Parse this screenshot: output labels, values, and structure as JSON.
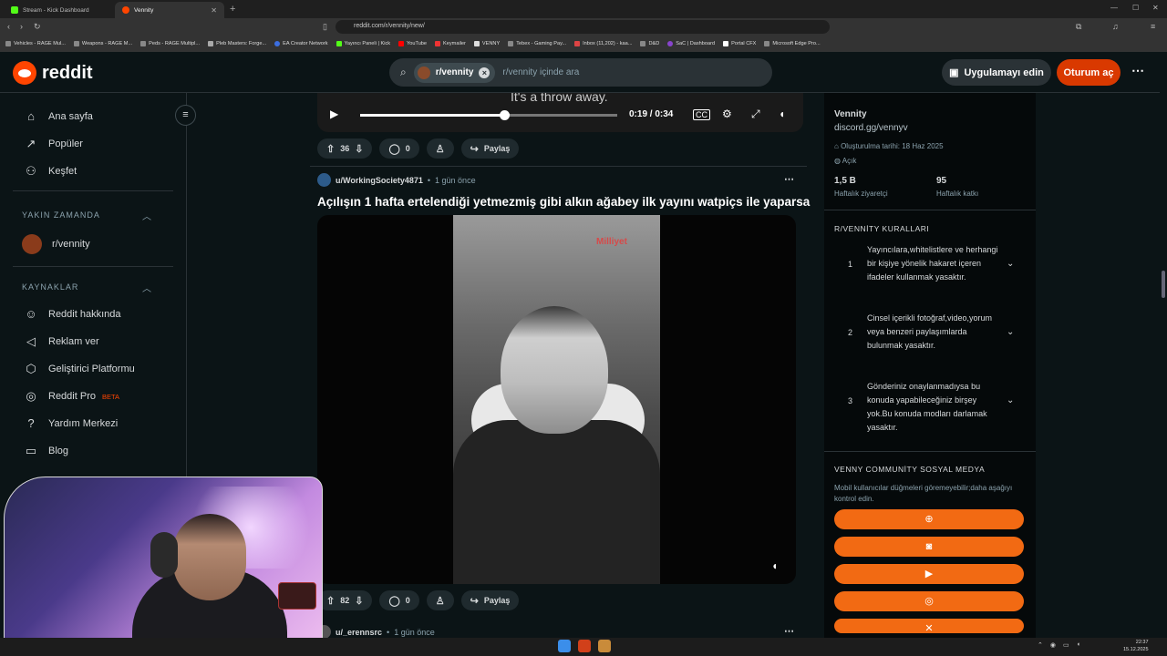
{
  "browser": {
    "tabs": [
      {
        "title": "Stream - Kick Dashboard",
        "color": "#53fc18"
      },
      {
        "title": "Vennity",
        "color": "#ff4500"
      }
    ],
    "url": "reddit.com/r/vennity/new/",
    "bookmarks": [
      "Vehicles - RAGE Mul...",
      "Weapons - RAGE M...",
      "Peds - RAGE Multipl...",
      "Pleb Masters: Forge...",
      "EA Creator Network",
      "Yayıncı Paneli | Kick",
      "YouTube",
      "Keymailer",
      "VENNY",
      "Tebex - Gaming Pay...",
      "Inbox (11,202) - kaa...",
      "D&D",
      "SaC | Dashboard",
      "Portal CFX",
      "Microsoft Edge Pro..."
    ]
  },
  "header": {
    "logo_text": "reddit",
    "search_chip": "r/vennity",
    "search_placeholder": "r/vennity içinde ara",
    "get_app_label": "Uygulamayı edin",
    "login_label": "Oturum aç"
  },
  "leftnav": {
    "items": [
      {
        "label": "Ana sayfa",
        "icon": "home-icon"
      },
      {
        "label": "Popüler",
        "icon": "popular-icon"
      },
      {
        "label": "Keşfet",
        "icon": "explore-icon"
      }
    ],
    "recent_title": "YAKIN ZAMANDA",
    "recent_items": [
      "r/vennity"
    ],
    "resources_title": "KAYNAKLAR",
    "resources": [
      {
        "label": "Reddit hakkında",
        "icon": "reddit-icon"
      },
      {
        "label": "Reklam ver",
        "icon": "megaphone-icon"
      },
      {
        "label": "Geliştirici Platformu",
        "icon": "hexagon-icon"
      },
      {
        "label": "Reddit Pro",
        "badge": "BETA",
        "icon": "reddit-pro-icon"
      },
      {
        "label": "Yardım Merkezi",
        "icon": "help-icon"
      },
      {
        "label": "Blog",
        "icon": "book-icon"
      }
    ]
  },
  "posts": [
    {
      "video_caption": "It's a throw away.",
      "video_time": "0:19 / 0:34",
      "video_progress": 0.56,
      "votes": "36",
      "comments": "0",
      "share_label": "Paylaş"
    },
    {
      "user": "u/WorkingSociety4871",
      "time": "1 gün önce",
      "title": "Açılışın 1 hafta ertelendiği yetmezmiş gibi alkın ağabey ilk yayını watpiçs ile yaparsa",
      "watermark": "Milliyet",
      "votes": "82",
      "comments": "0",
      "share_label": "Paylaş"
    },
    {
      "user": "u/_erennsrc",
      "time": "1 gün önce"
    }
  ],
  "community": {
    "name": "Vennity",
    "link": "discord.gg/vennyv",
    "created": "Oluşturulma tarihi: 18 Haz 2025",
    "visibility": "Açık",
    "weekly_visitors": "1,5 B",
    "weekly_visitors_label": "Haftalık ziyaretçi",
    "weekly_contrib": "95",
    "weekly_contrib_label": "Haftalık katkı",
    "rules_title": "R/VENNİTY KURALLARI",
    "rules": [
      {
        "n": "1",
        "text": "Yayıncılara,whitelistlere ve herhangi bir kişiye yönelik hakaret içeren ifadeler kullanmak yasaktır."
      },
      {
        "n": "2",
        "text": "Cinsel içerikli fotoğraf,video,yorum veya benzeri paylaşımlarda bulunmak yasaktır."
      },
      {
        "n": "3",
        "text": "Gönderiniz onaylanmadıysa bu konuda yapabileceğiniz birşey yok.Bu konuda modları darlamak yasaktır."
      }
    ],
    "social_title": "VENNY COMMUNİTY SOSYAL MEDYA",
    "social_note": "Mobil kullanıcılar düğmeleri göremeyebilir;daha aşağıyı kontrol edin.",
    "social_buttons": [
      "web-icon",
      "discord-icon",
      "youtube-icon",
      "instagram-icon",
      "x-icon"
    ],
    "accent": "#f26a13"
  },
  "taskbar": {
    "time": "22:37",
    "date": "15.12.2025"
  }
}
